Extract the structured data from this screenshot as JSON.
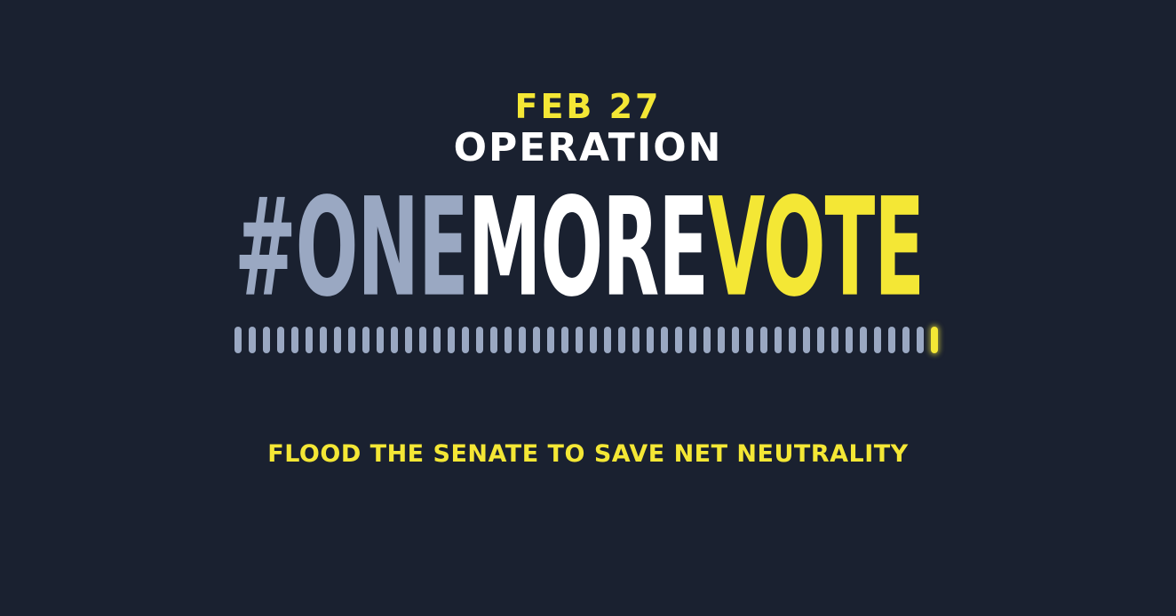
{
  "colors": {
    "background": "#1a2130",
    "yellow": "#f4e735",
    "white": "#ffffff",
    "slate": "#9aa8c2"
  },
  "header": {
    "date": "FEB 27",
    "operation": "OPERATION"
  },
  "hashtag": {
    "part1": "#ONE",
    "part2": "MORE",
    "part3": "VOTE"
  },
  "vote_meter": {
    "total_ticks": 50,
    "active_tick": 50
  },
  "tagline": "FLOOD THE SENATE TO SAVE NET NEUTRALITY"
}
